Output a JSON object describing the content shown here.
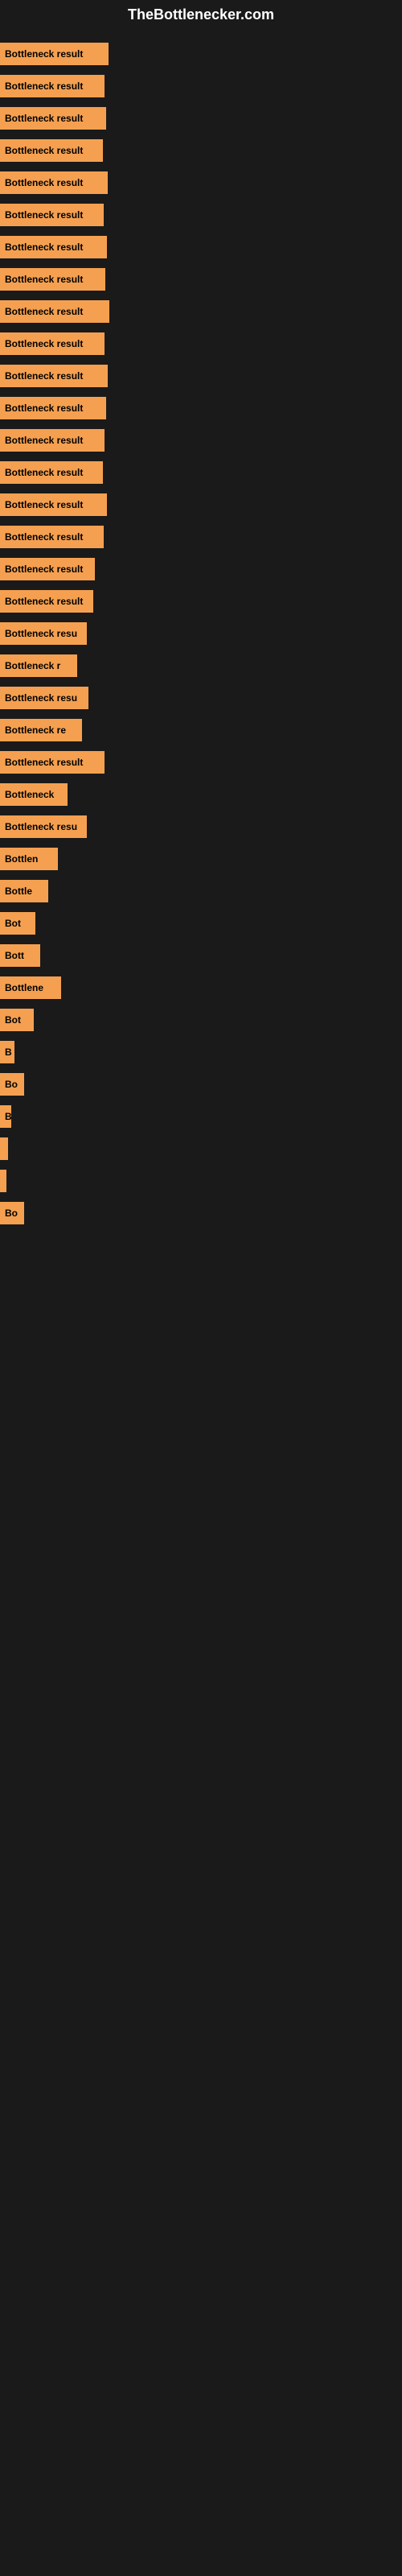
{
  "site": {
    "title": "TheBottlenecker.com"
  },
  "bars": [
    {
      "label": "Bottleneck result",
      "width": 135
    },
    {
      "label": "Bottleneck result",
      "width": 130
    },
    {
      "label": "Bottleneck result",
      "width": 132
    },
    {
      "label": "Bottleneck result",
      "width": 128
    },
    {
      "label": "Bottleneck result",
      "width": 134
    },
    {
      "label": "Bottleneck result",
      "width": 129
    },
    {
      "label": "Bottleneck result",
      "width": 133
    },
    {
      "label": "Bottleneck result",
      "width": 131
    },
    {
      "label": "Bottleneck result",
      "width": 136
    },
    {
      "label": "Bottleneck result",
      "width": 130
    },
    {
      "label": "Bottleneck result",
      "width": 134
    },
    {
      "label": "Bottleneck result",
      "width": 132
    },
    {
      "label": "Bottleneck result",
      "width": 130
    },
    {
      "label": "Bottleneck result",
      "width": 128
    },
    {
      "label": "Bottleneck result",
      "width": 133
    },
    {
      "label": "Bottleneck result",
      "width": 129
    },
    {
      "label": "Bottleneck result",
      "width": 118
    },
    {
      "label": "Bottleneck result",
      "width": 116
    },
    {
      "label": "Bottleneck resu",
      "width": 108
    },
    {
      "label": "Bottleneck r",
      "width": 96
    },
    {
      "label": "Bottleneck resu",
      "width": 110
    },
    {
      "label": "Bottleneck re",
      "width": 102
    },
    {
      "label": "Bottleneck result",
      "width": 130
    },
    {
      "label": "Bottleneck",
      "width": 84
    },
    {
      "label": "Bottleneck resu",
      "width": 108
    },
    {
      "label": "Bottlen",
      "width": 72
    },
    {
      "label": "Bottle",
      "width": 60
    },
    {
      "label": "Bot",
      "width": 44
    },
    {
      "label": "Bott",
      "width": 50
    },
    {
      "label": "Bottlene",
      "width": 76
    },
    {
      "label": "Bot",
      "width": 42
    },
    {
      "label": "B",
      "width": 18
    },
    {
      "label": "Bo",
      "width": 30
    },
    {
      "label": "B",
      "width": 14
    },
    {
      "label": "",
      "width": 10
    },
    {
      "label": "",
      "width": 8
    },
    {
      "label": "Bo",
      "width": 30
    }
  ]
}
